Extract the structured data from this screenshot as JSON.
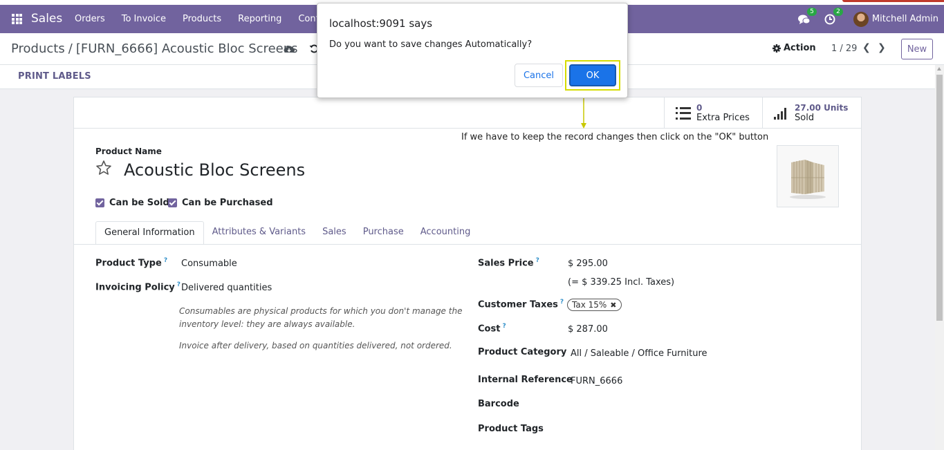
{
  "navbar": {
    "app_name": "Sales",
    "menu": [
      "Orders",
      "To Invoice",
      "Products",
      "Reporting",
      "Configu"
    ],
    "messages_count": "5",
    "activities_count": "2",
    "user_name": "Mitchell Admin",
    "colors": {
      "bar": "#71639e",
      "badge": "#28a745"
    }
  },
  "control_panel": {
    "breadcrumb_parent": "Products",
    "breadcrumb_separator": "/",
    "breadcrumb_current": "[FURN_6666] Acoustic Bloc Screens",
    "action_label": "Action",
    "pager_text": "1 / 29",
    "new_label": "New"
  },
  "statusbar": {
    "print_labels": "PRINT LABELS"
  },
  "smart_buttons": [
    {
      "value": "0",
      "label": "Extra Prices",
      "icon": "list-icon"
    },
    {
      "value": "27.00 Units",
      "label": "Sold",
      "icon": "signal-bars-icon"
    }
  ],
  "annotation_text": "If we have to keep the record changes then click on the \"OK\" button",
  "product": {
    "name_label": "Product Name",
    "name": "Acoustic Bloc Screens",
    "can_be_sold": "Can be Sold",
    "can_be_purchased": "Can be Purchased"
  },
  "tabs": [
    "General Information",
    "Attributes & Variants",
    "Sales",
    "Purchase",
    "Accounting"
  ],
  "general_info": {
    "product_type_label": "Product Type",
    "product_type": "Consumable",
    "invoicing_policy_label": "Invoicing Policy",
    "invoicing_policy": "Delivered quantities",
    "help_consumable_1": "Consumables are physical products for which you don't manage the",
    "help_consumable_2": "inventory level: they are always available.",
    "help_invoice": "Invoice after delivery, based on quantities delivered, not ordered.",
    "sales_price_label": "Sales Price",
    "sales_price": "$ 295.00",
    "sales_price_incl": "(= $ 339.25 Incl. Taxes)",
    "customer_taxes_label": "Customer Taxes",
    "customer_tax_tag": "Tax 15%",
    "cost_label": "Cost",
    "cost": "$ 287.00",
    "product_category_label": "Product Category",
    "product_category": "All / Saleable / Office Furniture",
    "internal_reference_label": "Internal Reference",
    "internal_reference": "FURN_6666",
    "barcode_label": "Barcode",
    "product_tags_label": "Product Tags",
    "help_marker": "?"
  },
  "dialog": {
    "title": "localhost:9091 says",
    "message": "Do you want to save changes Automatically?",
    "cancel_label": "Cancel",
    "ok_label": "OK",
    "highlight_color": "#d6dc00"
  }
}
